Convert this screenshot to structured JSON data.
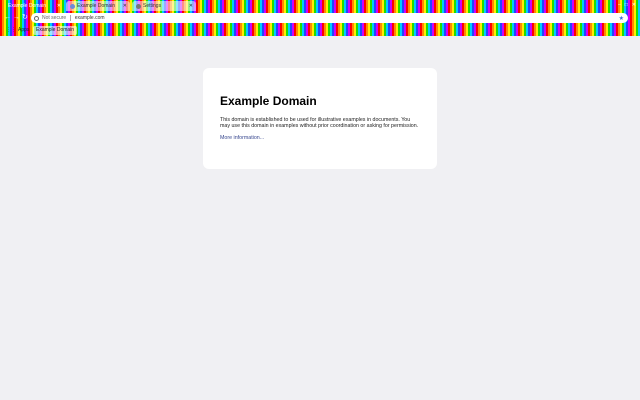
{
  "tabs": [
    {
      "label": "Example Domain",
      "active": true
    },
    {
      "label": "Example Domain",
      "active": false
    },
    {
      "label": "Settings",
      "active": false
    }
  ],
  "window_controls": {
    "minimize": "–",
    "maximize": "□",
    "close": "✕"
  },
  "toolbar": {
    "back": "←",
    "forward": "→",
    "reload": "↻",
    "security_label": "Not secure",
    "url": "example.com",
    "star": "★"
  },
  "bookmarks": {
    "apps_label": "Apps",
    "items": [
      {
        "label": "Example Domain"
      }
    ]
  },
  "page": {
    "title": "Example Domain",
    "body": "This domain is established to be used for illustrative examples in documents. You may use this domain in examples without prior coordination or asking for permission.",
    "link": "More information..."
  },
  "colors": {
    "page_bg": "#f0f0f3",
    "card_bg": "#ffffff",
    "link": "#38488f"
  }
}
